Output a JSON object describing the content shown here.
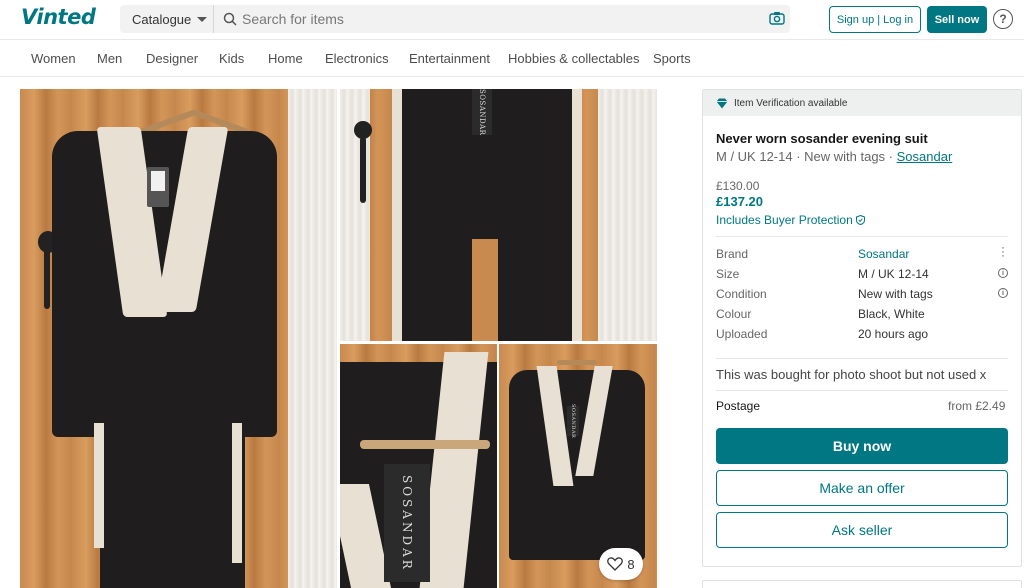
{
  "brand": {
    "logo": "Vinted",
    "accent": "#007782"
  },
  "header": {
    "catalogue_label": "Catalogue",
    "search_placeholder": "Search for items",
    "signup_label": "Sign up | Log in",
    "sell_label": "Sell now",
    "help_label": "?"
  },
  "nav": {
    "items": [
      "Women",
      "Men",
      "Designer",
      "Kids",
      "Home",
      "Electronics",
      "Entertainment",
      "Hobbies & collectables",
      "Sports"
    ]
  },
  "gallery": {
    "tag_text": "SOSANDAR",
    "favourites_count": "8"
  },
  "item": {
    "verification_label": "Item Verification available",
    "title": "Never worn sosander evening suit",
    "subtitle_prefix": "M / UK 12-14 · New with tags · ",
    "subtitle_brand": "Sosandar",
    "price_original": "£130.00",
    "price_total": "£137.20",
    "buyer_protection": "Includes Buyer Protection",
    "attributes": [
      {
        "label": "Brand",
        "value": "Sosandar"
      },
      {
        "label": "Size",
        "value": "M / UK 12-14"
      },
      {
        "label": "Condition",
        "value": "New with tags"
      },
      {
        "label": "Colour",
        "value": "Black, White"
      },
      {
        "label": "Uploaded",
        "value": "20 hours ago"
      }
    ],
    "description": "This was bought for photo shoot but not used x",
    "postage_label": "Postage",
    "postage_value": "from £2.49",
    "buy_now_label": "Buy now",
    "make_offer_label": "Make an offer",
    "ask_seller_label": "Ask seller"
  }
}
